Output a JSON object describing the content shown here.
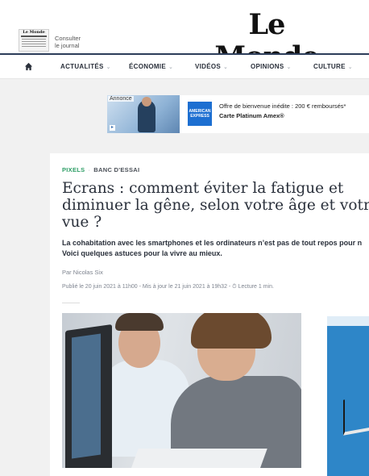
{
  "header": {
    "consult_line1": "Consulter",
    "consult_line2": "le journal",
    "logo": "Le Monde",
    "journal_mast": "Le Monde"
  },
  "nav": {
    "home_icon": "home-icon",
    "items": [
      {
        "label": "ACTUALITÉS"
      },
      {
        "label": "ÉCONOMIE"
      },
      {
        "label": "VIDÉOS"
      },
      {
        "label": "OPINIONS"
      },
      {
        "label": "CULTURE"
      }
    ]
  },
  "ad": {
    "label": "Annonce",
    "brand_logo": "AMERICAN EXPRESS",
    "line1": "Offre de bienvenue inédite : 200 € remboursés*",
    "line2": "Carte Platinum Amex®"
  },
  "article": {
    "kicker_section": "PIXELS",
    "kicker_rubric": "BANC D'ESSAI",
    "title_lines": [
      "Ecrans : comment éviter la fatigue et",
      "diminuer la gêne, selon votre âge et votre",
      "vue ?"
    ],
    "chapo_lines": [
      "La cohabitation avec les smartphones et les ordinateurs n’est pas de tout repos pour n",
      "Voici quelques astuces pour la vivre au mieux."
    ],
    "author": "Par Nicolas Six",
    "meta": "Publié le 20 juin 2021 à 11h00 - Mis à jour le 21 juin 2021 à 19h32 - ⏱ Lecture 1 min."
  },
  "colors": {
    "nav_border": "#2c3d5a",
    "pixels_green": "#2e9e66",
    "background_gray": "#f1f1f1",
    "amex_blue": "#1d6fd1"
  }
}
